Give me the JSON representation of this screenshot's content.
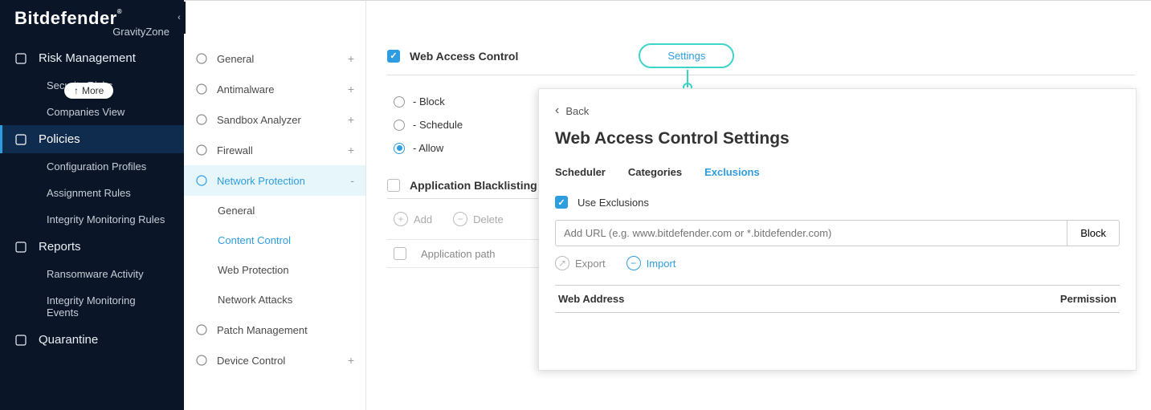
{
  "brand": {
    "name": "Bitdefender",
    "sub": "GravityZone"
  },
  "more_badge": "More",
  "sidebar": {
    "items": [
      {
        "label": "Risk Management",
        "icon": "risk-icon",
        "top": true
      },
      {
        "label": "Security Risks",
        "sub": true
      },
      {
        "label": "Companies View",
        "sub": true
      },
      {
        "label": "Policies",
        "icon": "policies-icon",
        "top": true,
        "active": true
      },
      {
        "label": "Configuration Profiles",
        "sub": true
      },
      {
        "label": "Assignment Rules",
        "sub": true
      },
      {
        "label": "Integrity Monitoring Rules",
        "sub": true
      },
      {
        "label": "Reports",
        "icon": "reports-icon",
        "top": true
      },
      {
        "label": "Ransomware Activity",
        "sub": true
      },
      {
        "label": "Integrity Monitoring Events",
        "sub": true
      },
      {
        "label": "Quarantine",
        "icon": "quarantine-icon",
        "top": true
      }
    ]
  },
  "policy_nav": [
    {
      "label": "General",
      "icon": "gear-icon",
      "expand": "+"
    },
    {
      "label": "Antimalware",
      "icon": "shield-icon",
      "expand": "+"
    },
    {
      "label": "Sandbox Analyzer",
      "icon": "cube-icon",
      "expand": "+"
    },
    {
      "label": "Firewall",
      "icon": "firewall-icon",
      "expand": "+"
    },
    {
      "label": "Network Protection",
      "icon": "network-icon",
      "expand": "-",
      "selected": true,
      "children": [
        {
          "label": "General"
        },
        {
          "label": "Content Control",
          "selected": true
        },
        {
          "label": "Web Protection"
        },
        {
          "label": "Network Attacks"
        }
      ]
    },
    {
      "label": "Patch Management",
      "icon": "patch-icon"
    },
    {
      "label": "Device Control",
      "icon": "device-icon",
      "expand": "+"
    }
  ],
  "main": {
    "web_access_control": "Web Access Control",
    "settings_label": "Settings",
    "radios": [
      {
        "label": "- Block"
      },
      {
        "label": "- Schedule"
      },
      {
        "label": "- Allow",
        "on": true
      }
    ],
    "app_blacklisting": "Application Blacklisting",
    "add": "Add",
    "delete": "Delete",
    "app_path": "Application path"
  },
  "panel": {
    "back": "Back",
    "title": "Web Access Control Settings",
    "tabs": [
      {
        "label": "Scheduler"
      },
      {
        "label": "Categories"
      },
      {
        "label": "Exclusions",
        "active": true
      }
    ],
    "use_exclusions": "Use Exclusions",
    "url_placeholder": "Add URL (e.g. www.bitdefender.com or *.bitdefender.com)",
    "block": "Block",
    "export": "Export",
    "import": "Import",
    "col_web": "Web Address",
    "col_perm": "Permission"
  }
}
